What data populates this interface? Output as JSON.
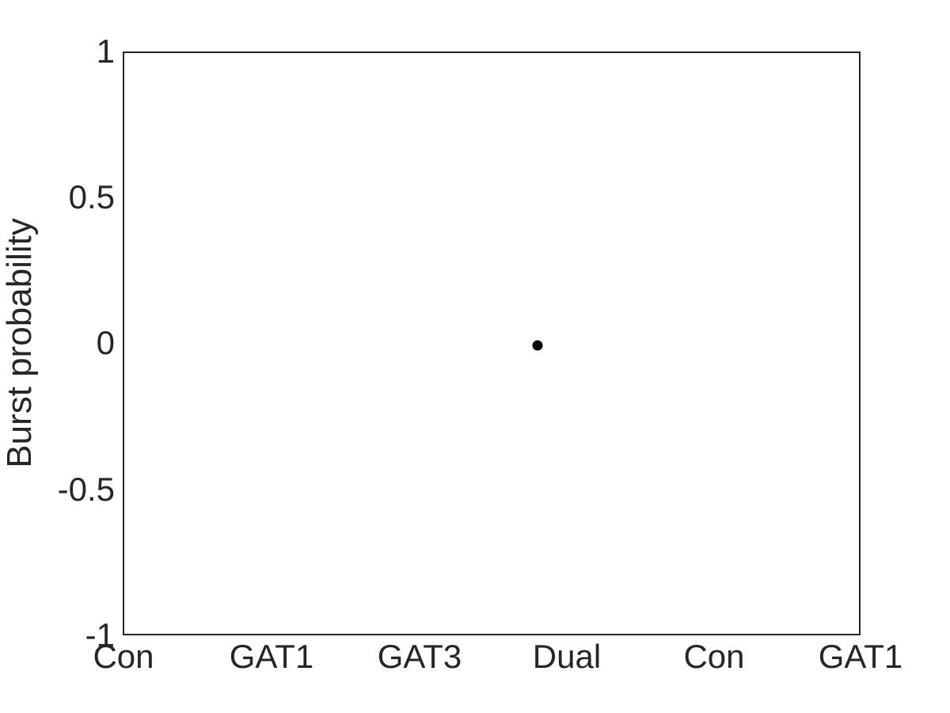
{
  "figure": {
    "background_color": "#ffffff",
    "axis_color": "#262626",
    "marker_color": "#000000"
  },
  "chart_data": {
    "type": "scatter",
    "title": "",
    "subtitle": "",
    "xlabel": "",
    "ylabel": "Burst probability",
    "xlim": [
      0.5,
      6.5
    ],
    "ylim": [
      -1,
      1
    ],
    "grid": false,
    "legend": null,
    "x_tick_positions": [
      1,
      2,
      3,
      4,
      5,
      6
    ],
    "categories": [
      "Con",
      "GAT1",
      "GAT3",
      "Dual",
      "Con",
      "GAT1"
    ],
    "y_tick_values": [
      1,
      0.5,
      0,
      -0.5,
      -1
    ],
    "y_tick_labels": [
      "1",
      "0.5",
      "0",
      "-0.5",
      "-1"
    ],
    "series": [
      {
        "name": "Burst probability",
        "marker": "filled-circle",
        "color": "#000000",
        "points": [
          {
            "x": 3.86,
            "y": 0,
            "label": ""
          }
        ]
      }
    ],
    "annotations": []
  }
}
